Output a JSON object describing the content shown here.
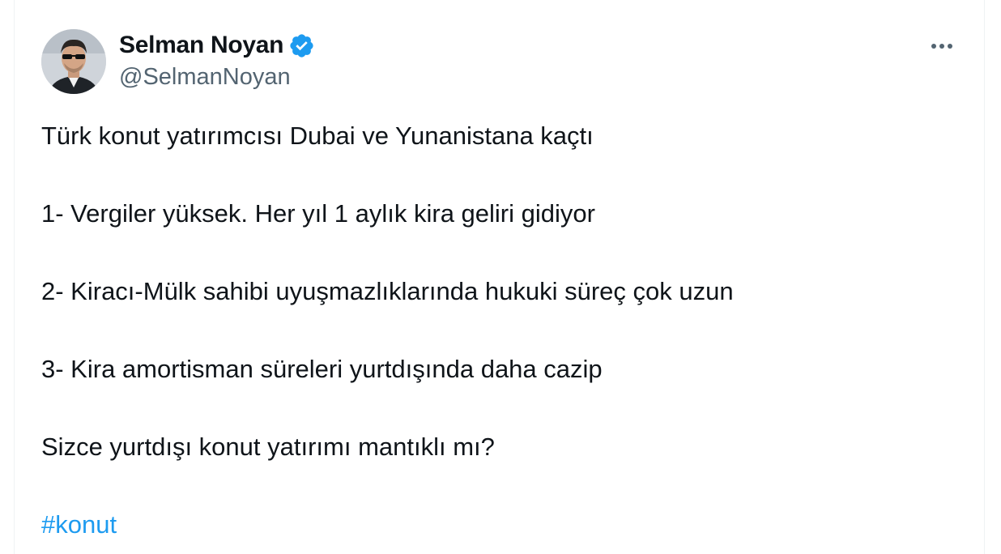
{
  "tweet": {
    "author": {
      "display_name": "Selman Noyan",
      "handle": "@SelmanNoyan",
      "verified": true
    },
    "more_icon": "more-horizontal-icon",
    "lines": [
      "Türk konut yatırımcısı Dubai ve Yunanistana kaçtı",
      "1- Vergiler yüksek. Her yıl 1 aylık kira geliri gidiyor",
      "2- Kiracı-Mülk sahibi uyuşmazlıklarında hukuki süreç çok uzun",
      "3- Kira amortisman süreleri yurtdışında daha cazip",
      "Sizce yurtdışı konut yatırımı mantıklı mı?"
    ],
    "hashtag": "#konut"
  },
  "colors": {
    "text": "#0f1419",
    "secondary_text": "#536471",
    "accent": "#1d9bf0"
  }
}
